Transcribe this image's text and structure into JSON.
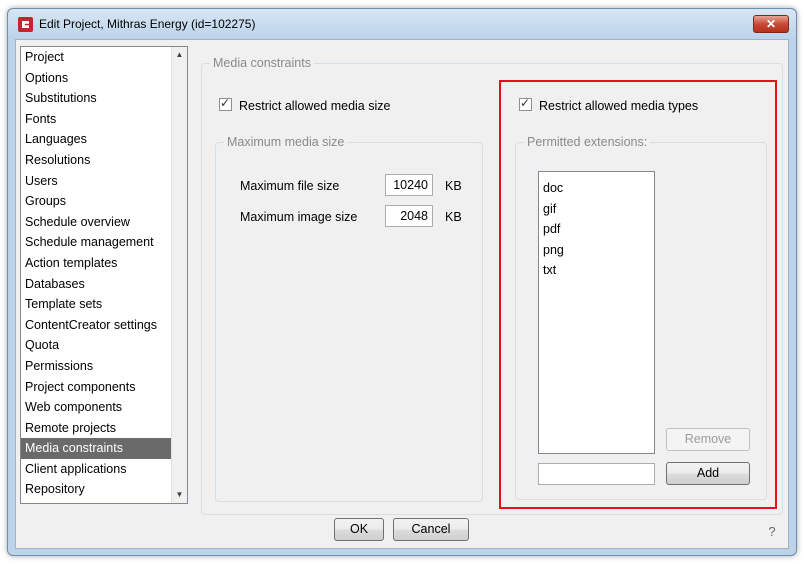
{
  "window": {
    "title": "Edit Project, Mithras Energy (id=102275)",
    "close_symbol": "✕"
  },
  "sidebar": {
    "items": [
      {
        "label": "Project"
      },
      {
        "label": "Options"
      },
      {
        "label": "Substitutions"
      },
      {
        "label": "Fonts"
      },
      {
        "label": "Languages"
      },
      {
        "label": "Resolutions"
      },
      {
        "label": "Users"
      },
      {
        "label": "Groups"
      },
      {
        "label": "Schedule overview"
      },
      {
        "label": "Schedule management"
      },
      {
        "label": "Action templates"
      },
      {
        "label": "Databases"
      },
      {
        "label": "Template sets"
      },
      {
        "label": "ContentCreator settings"
      },
      {
        "label": "Quota"
      },
      {
        "label": "Permissions"
      },
      {
        "label": "Project components"
      },
      {
        "label": "Web components"
      },
      {
        "label": "Remote projects"
      },
      {
        "label": "Media constraints",
        "selected": true
      },
      {
        "label": "Client applications"
      },
      {
        "label": "Repository"
      }
    ]
  },
  "media_constraints": {
    "group_title": "Media constraints",
    "restrict_size": {
      "label": "Restrict allowed media size",
      "checked": true
    },
    "max_size_group": {
      "title": "Maximum media size",
      "file_size": {
        "label": "Maximum file size",
        "value": "10240",
        "unit": "KB"
      },
      "image_size": {
        "label": "Maximum image size",
        "value": "2048",
        "unit": "KB"
      }
    },
    "restrict_types": {
      "label": "Restrict allowed media types",
      "checked": true
    },
    "extensions_group": {
      "title": "Permitted extensions:",
      "items": [
        "doc",
        "gif",
        "pdf",
        "png",
        "txt"
      ],
      "new_extension_value": "",
      "remove_label": "Remove",
      "add_label": "Add"
    }
  },
  "footer": {
    "ok_label": "OK",
    "cancel_label": "Cancel",
    "help_symbol": "?"
  },
  "colors": {
    "highlight": "#e3121b",
    "selected_item": "#6a6a6a"
  }
}
